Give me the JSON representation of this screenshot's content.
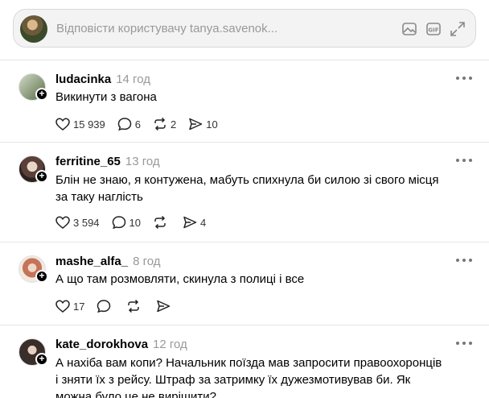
{
  "reply_bar": {
    "placeholder": "Відповісти користувачу tanya.savenok...",
    "icons": [
      "image-icon",
      "gif-icon",
      "expand-icon"
    ]
  },
  "comments": [
    {
      "username": "ludacinka",
      "time": "14 год",
      "text": "Викинути з вагона",
      "likes": "15 939",
      "replies": "6",
      "reposts": "2",
      "shares": "10"
    },
    {
      "username": "ferritine_65",
      "time": "13 год",
      "text": "Блін не знаю, я контужена, мабуть спихнула би силою зі свого місця за таку наглість",
      "likes": "3 594",
      "replies": "10",
      "reposts": "",
      "shares": "4"
    },
    {
      "username": "mashe_alfa_",
      "time": "8 год",
      "text": "А що там розмовляти, скинула з полиці і все",
      "likes": "17",
      "replies": "",
      "reposts": "",
      "shares": ""
    },
    {
      "username": "kate_dorokhova",
      "time": "12 год",
      "text": "А нахіба вам копи? Начальник поїзда мав запросити правоохоронців і зняти їх з рейсу. Штраф за затримку їх дужезмотивував би. Як можна було це не вирішити?",
      "likes": "",
      "replies": "",
      "reposts": "",
      "shares": ""
    }
  ],
  "colors": {
    "text": "#000000",
    "muted": "#999999",
    "border": "#d9d9d9",
    "bar_bg": "#f3f3f3"
  }
}
